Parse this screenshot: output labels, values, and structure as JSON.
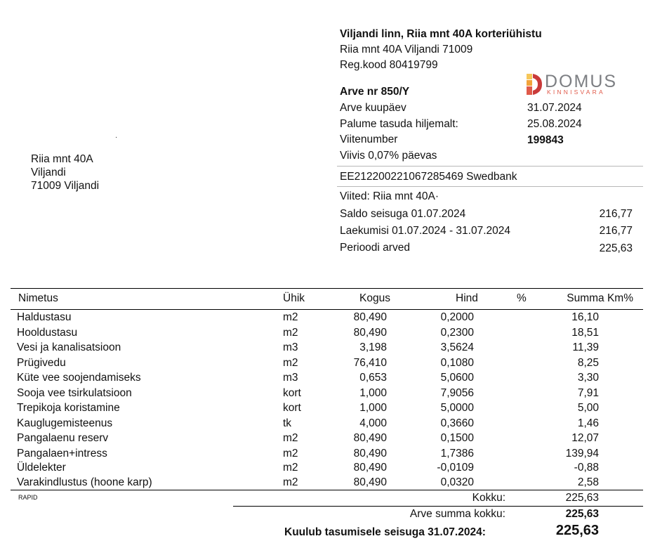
{
  "association": {
    "name": "Viljandi linn, Riia mnt 40A korteriühistu",
    "address": "Riia mnt 40A Viljandi  71009",
    "reg_code": "Reg.kood  80419799"
  },
  "logo": {
    "word": "DOMUS",
    "sub": "KINNISVARA",
    "colors": [
      "#f2a33a",
      "#e05a4a",
      "#c93a3a",
      "#f6c75a"
    ]
  },
  "invoice": {
    "number": "Arve nr 850/Y",
    "date_label": "Arve kuupäev",
    "date_value": "31.07.2024",
    "due_label": "Palume tasuda hiljemalt:",
    "due_value": "25.08.2024",
    "ref_label": "Viitenumber",
    "ref_value": "199843",
    "penalty": "Viivis  0,07% päevas",
    "bank_account": "EE212200221067285469   Swedbank"
  },
  "recipient": {
    "line1": "Riia mnt 40A",
    "line2": "Viljandi",
    "line3": "71009 Viljandi",
    "mark": "·"
  },
  "balance": {
    "refs": "Viited: Riia mnt 40A·",
    "rows": [
      {
        "label": "Saldo seisuga 01.07.2024",
        "value": "216,77"
      },
      {
        "label": "Laekumisi 01.07.2024 - 31.07.2024",
        "value": "216,77"
      },
      {
        "label": "Perioodi arved",
        "value": "225,63"
      }
    ]
  },
  "table": {
    "headers": {
      "name": "Nimetus",
      "unit": "Ühik",
      "qty": "Kogus",
      "price": "Hind",
      "pct": "%",
      "sum": "Summa Km%"
    },
    "rows": [
      {
        "name": "Haldustasu",
        "unit": "m2",
        "qty": "80,490",
        "price": "0,2000",
        "sum": "16,10"
      },
      {
        "name": "Hooldustasu",
        "unit": "m2",
        "qty": "80,490",
        "price": "0,2300",
        "sum": "18,51"
      },
      {
        "name": "Vesi ja kanalisatsioon",
        "unit": "m3",
        "qty": "3,198",
        "price": "3,5624",
        "sum": "11,39"
      },
      {
        "name": "Prügivedu",
        "unit": "m2",
        "qty": "76,410",
        "price": "0,1080",
        "sum": "8,25"
      },
      {
        "name": "Küte vee soojendamiseks",
        "unit": "m3",
        "qty": "0,653",
        "price": "5,0600",
        "sum": "3,30"
      },
      {
        "name": "Sooja vee tsirkulatsioon",
        "unit": "kort",
        "qty": "1,000",
        "price": "7,9056",
        "sum": "7,91"
      },
      {
        "name": "Trepikoja koristamine",
        "unit": "kort",
        "qty": "1,000",
        "price": "5,0000",
        "sum": "5,00"
      },
      {
        "name": "Kauglugemisteenus",
        "unit": "tk",
        "qty": "4,000",
        "price": "0,3660",
        "sum": "1,46"
      },
      {
        "name": "Pangalaenu reserv",
        "unit": "m2",
        "qty": "80,490",
        "price": "0,1500",
        "sum": "12,07"
      },
      {
        "name": "Pangalaen+intress",
        "unit": "m2",
        "qty": "80,490",
        "price": "1,7386",
        "sum": "139,94"
      },
      {
        "name": "Üldelekter",
        "unit": "m2",
        "qty": "80,490",
        "price": "-0,0109",
        "sum": "-0,88"
      },
      {
        "name": "Varakindlustus (hoone karp)",
        "unit": "m2",
        "qty": "80,490",
        "price": "0,0320",
        "sum": "2,58"
      }
    ]
  },
  "totals": {
    "rapid": "RAPID",
    "total_label": "Kokku:",
    "total_value": "225,63",
    "grand_label": "Arve summa kokku:",
    "grand_value": "225,63",
    "due_label": "Kuulub tasumisele seisuga 31.07.2024:",
    "due_value": "225,63"
  }
}
